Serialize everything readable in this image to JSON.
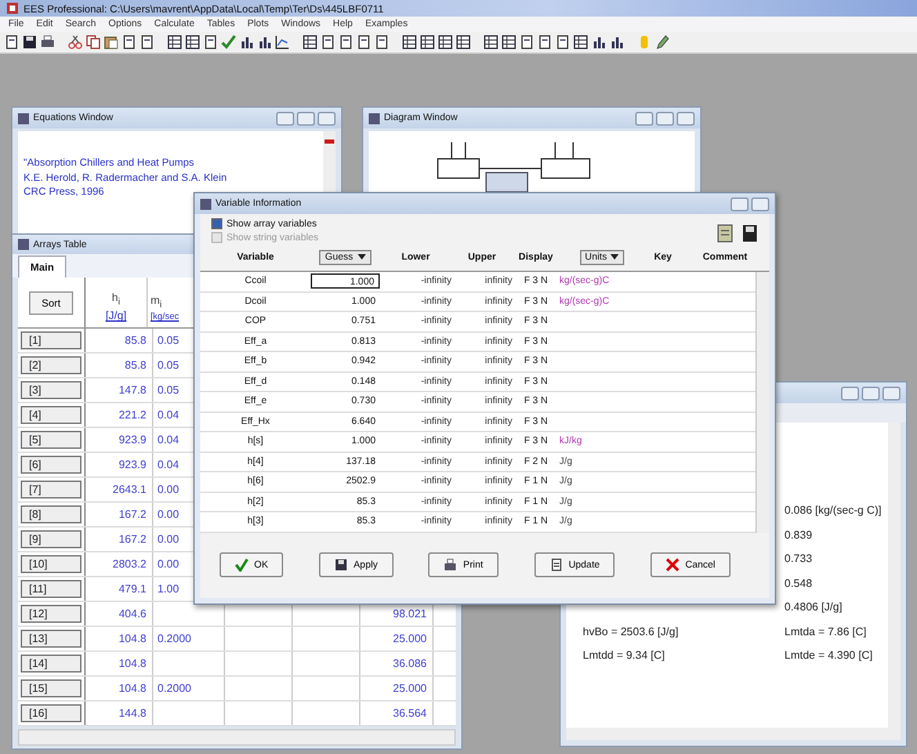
{
  "window": {
    "title": "EES Professional: C:\\Users\\mavrent\\AppData\\Local\\Temp\\Ter\\Ds\\445LBF0711"
  },
  "menu": [
    "File",
    "Edit",
    "Search",
    "Options",
    "Calculate",
    "Tables",
    "Plots",
    "Windows",
    "Help",
    "Examples"
  ],
  "equations_window": {
    "title": "Equations Window",
    "lines": [
      "\"Absorption Chillers and Heat Pumps",
      "K.E. Herold, R. Radermacher and S.A. Klein",
      "CRC Press, 1996"
    ]
  },
  "diagram_window": {
    "title": "Diagram Window"
  },
  "arrays_table": {
    "title": "Arrays Table",
    "tabs": [
      {
        "label": "Main",
        "selected": true
      }
    ],
    "sort_button": "Sort",
    "columns": [
      {
        "name": "h$_{i}$",
        "unit": "[J/g]"
      },
      {
        "name": "m$_{i}$",
        "unit": "[kg/sec"
      }
    ],
    "rows": [
      {
        "label": "[1]",
        "h": "85.8",
        "m": "0.05"
      },
      {
        "label": "[2]",
        "h": "85.8",
        "m": "0.05"
      },
      {
        "label": "[3]",
        "h": "147.8",
        "m": "0.05"
      },
      {
        "label": "[4]",
        "h": "221.2",
        "m": "0.04"
      },
      {
        "label": "[5]",
        "h": "923.9",
        "m": "0.04"
      },
      {
        "label": "[6]",
        "h": "923.9",
        "m": "0.04"
      },
      {
        "label": "[7]",
        "h": "2643.1",
        "m": "0.00"
      },
      {
        "label": "[8]",
        "h": "167.2",
        "m": "0.00"
      },
      {
        "label": "[9]",
        "h": "167.2",
        "m": "0.00"
      },
      {
        "label": "[10]",
        "h": "2803.2",
        "m": "0.00"
      },
      {
        "label": "[11]",
        "h": "479.1",
        "m": "1.00"
      },
      {
        "label": "[12]",
        "h": "404.6",
        "column_5": "98.021"
      },
      {
        "label": "[13]",
        "h": "104.8",
        "m": "0.2000",
        "column_5": "25.000"
      },
      {
        "label": "[14]",
        "h": "104.8",
        "column_5": "36.086"
      },
      {
        "label": "[15]",
        "h": "104.8",
        "m": "0.2000",
        "column_5": "25.000"
      },
      {
        "label": "[16]",
        "h": "144.8",
        "column_5": "36.564"
      }
    ]
  },
  "solution_window": {
    "right_lines": [
      "0.086 [kg/(sec-g C)]",
      "0.839",
      "0.733",
      "0.548",
      "0.4806 [J/g]"
    ],
    "pairs": [
      {
        "left": "hvBo = 2503.6 [J/g]",
        "right": "Lmtda = 7.86 [C]"
      },
      {
        "left": "Lmtdd = 9.34 [C]",
        "right": "Lmtde = 4.390 [C]"
      }
    ]
  },
  "dialog": {
    "title": "Variable Information",
    "options": [
      {
        "label": "Show array variables",
        "checked": true,
        "disabled": false
      },
      {
        "label": "Show string variables",
        "checked": false,
        "disabled": true
      }
    ],
    "headers": {
      "variable": "Variable",
      "guess": "Guess",
      "lower": "Lower",
      "upper": "Upper",
      "display": "Display",
      "units": "Units",
      "key": "Key",
      "comment": "Comment"
    },
    "rows": [
      {
        "variable": "Ccoil",
        "guess": "1.000",
        "lower": "-infinity",
        "upper": "infinity",
        "display": "F 3 N",
        "units": "kg/(sec-g)C",
        "selected": true
      },
      {
        "variable": "Dcoil",
        "guess": "1.000",
        "lower": "-infinity",
        "upper": "infinity",
        "display": "F 3 N",
        "units": "kg/(sec-g)C",
        "selected": false
      },
      {
        "variable": "COP",
        "guess": "0.751",
        "lower": "-infinity",
        "upper": "infinity",
        "display": "F 3 N",
        "selected": false
      },
      {
        "variable": "Eff_a",
        "guess": "0.813",
        "lower": "-infinity",
        "upper": "infinity",
        "display": "F 3 N",
        "selected": false
      },
      {
        "variable": "Eff_b",
        "guess": "0.942",
        "lower": "-infinity",
        "upper": "infinity",
        "display": "F 3 N",
        "selected": false
      },
      {
        "variable": "Eff_d",
        "guess": "0.148",
        "lower": "-infinity",
        "upper": "infinity",
        "display": "F 3 N",
        "selected": false
      },
      {
        "variable": "Eff_e",
        "guess": "0.730",
        "lower": "-infinity",
        "upper": "infinity",
        "display": "F 3 N",
        "selected": false
      },
      {
        "variable": "Eff_Hx",
        "guess": "6.640",
        "lower": "-infinity",
        "upper": "infinity",
        "display": "F 3 N",
        "selected": false
      },
      {
        "variable": "h[s]",
        "guess": "1.000",
        "lower": "-infinity",
        "upper": "infinity",
        "display": "F 3 N",
        "units": "kJ/kg",
        "selected": false
      },
      {
        "variable": "h[4]",
        "guess": "137.18",
        "lower": "-infinity",
        "upper": "infinity",
        "display": "F 2 N",
        "units": "J/g",
        "selected": false
      },
      {
        "variable": "h[6]",
        "guess": "2502.9",
        "lower": "-infinity",
        "upper": "infinity",
        "display": "F 1 N",
        "units": "J/g",
        "selected": false
      },
      {
        "variable": "h[2]",
        "guess": "85.3",
        "lower": "-infinity",
        "upper": "infinity",
        "display": "F 1 N",
        "units": "J/g",
        "selected": false
      },
      {
        "variable": "h[3]",
        "guess": "85.3",
        "lower": "-infinity",
        "upper": "infinity",
        "display": "F 1 N",
        "units": "J/g",
        "selected": false
      }
    ],
    "buttons": [
      {
        "kind": "ok",
        "label": "OK"
      },
      {
        "kind": "apply",
        "label": "Apply"
      },
      {
        "kind": "print",
        "label": "Print"
      },
      {
        "kind": "update",
        "label": "Update"
      },
      {
        "kind": "cancel",
        "label": "Cancel"
      }
    ]
  }
}
